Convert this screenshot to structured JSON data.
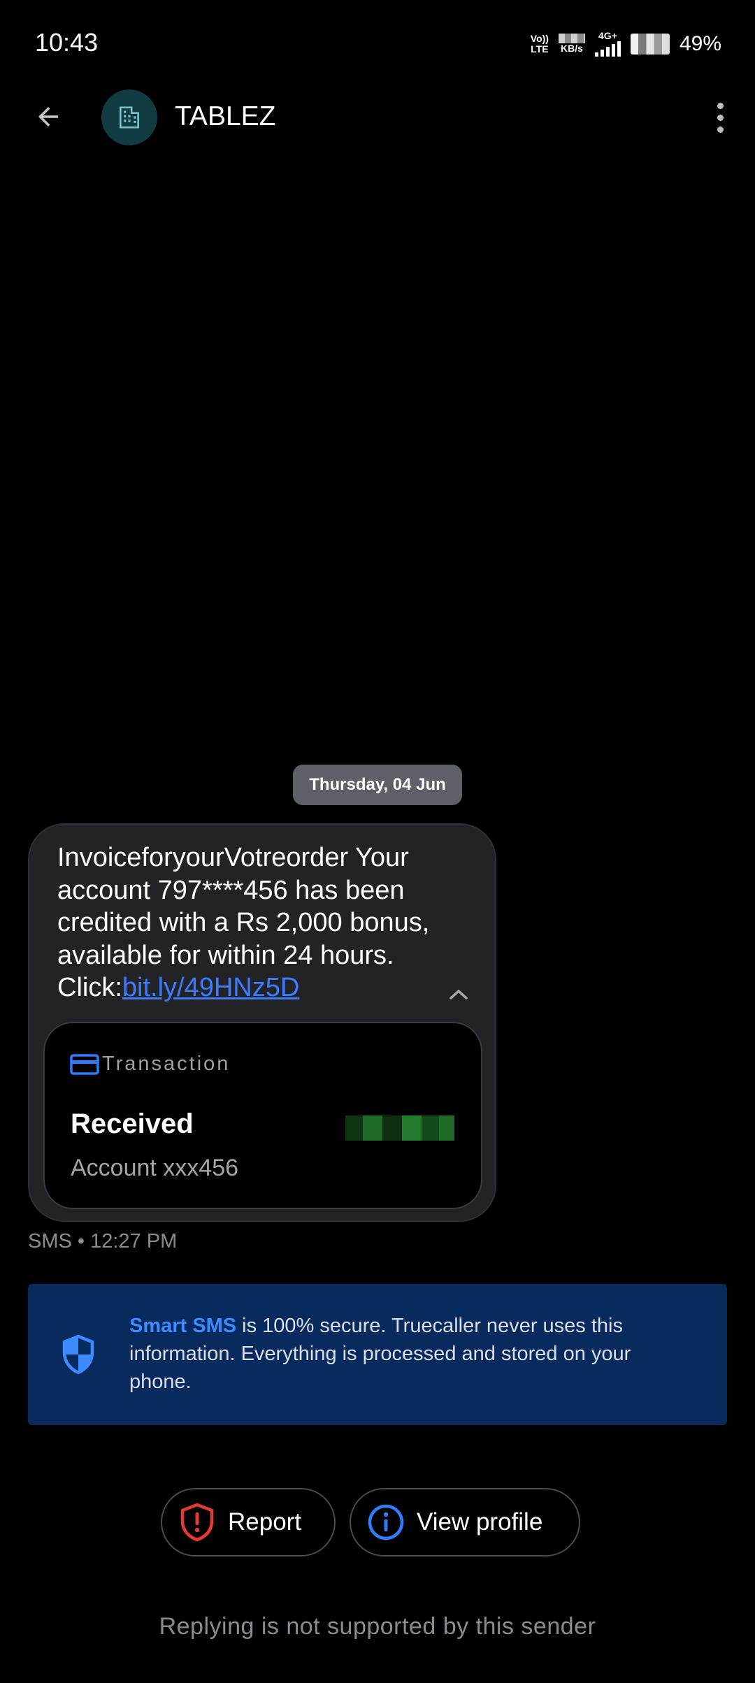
{
  "status_bar": {
    "time": "10:43",
    "volte_top": "Vo))",
    "volte_bottom": "LTE",
    "speed_unit": "KB/s",
    "network": "4G+",
    "battery": "49%"
  },
  "header": {
    "contact_name": "TABLEZ",
    "avatar_icon": "building-icon"
  },
  "conversation": {
    "date_chip": "Thursday, 04 Jun",
    "message": {
      "text": "InvoiceforyourVotreorder Your account 797****456 has been credited with a Rs 2,000 bonus, available for  within 24 hours. Click:",
      "link": "bit.ly/49HNz5D",
      "meta": "SMS • 12:27 PM"
    },
    "transaction_card": {
      "label": "Transaction",
      "title": "Received",
      "subtitle": "Account xxx456"
    }
  },
  "banner": {
    "highlight": "Smart SMS",
    "text": " is 100% secure. Truecaller never uses this information. Everything is processed and stored on your phone."
  },
  "actions": {
    "report_label": "Report",
    "view_profile_label": "View profile"
  },
  "footer": {
    "reply_note": "Replying is not supported by this sender"
  },
  "colors": {
    "background": "#000000",
    "bubble": "#222327",
    "link": "#3d7cff",
    "banner": "#082a5c",
    "report_icon": "#e53935",
    "info_icon": "#2f7cff"
  }
}
